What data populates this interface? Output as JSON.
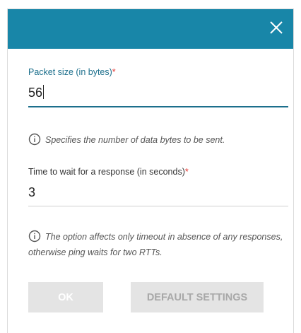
{
  "dialog": {
    "packet_size": {
      "label": "Packet size (in bytes)",
      "required_mark": "*",
      "value": "56",
      "hint": "Specifies the number of data bytes to be sent."
    },
    "timeout": {
      "label": "Time to wait for a response (in seconds)",
      "required_mark": "*",
      "value": "3",
      "hint": "The option affects only timeout in absence of any responses, otherwise ping waits for two RTTs."
    },
    "buttons": {
      "ok_label": "OK",
      "defaults_label": "DEFAULT SETTINGS"
    },
    "icons": {
      "close": "close-icon",
      "info": "info-icon"
    },
    "colors": {
      "header": "#1886a8",
      "accent": "#1c6f8c",
      "required": "#e53935",
      "button_disabled": "#e4e4e4"
    }
  }
}
